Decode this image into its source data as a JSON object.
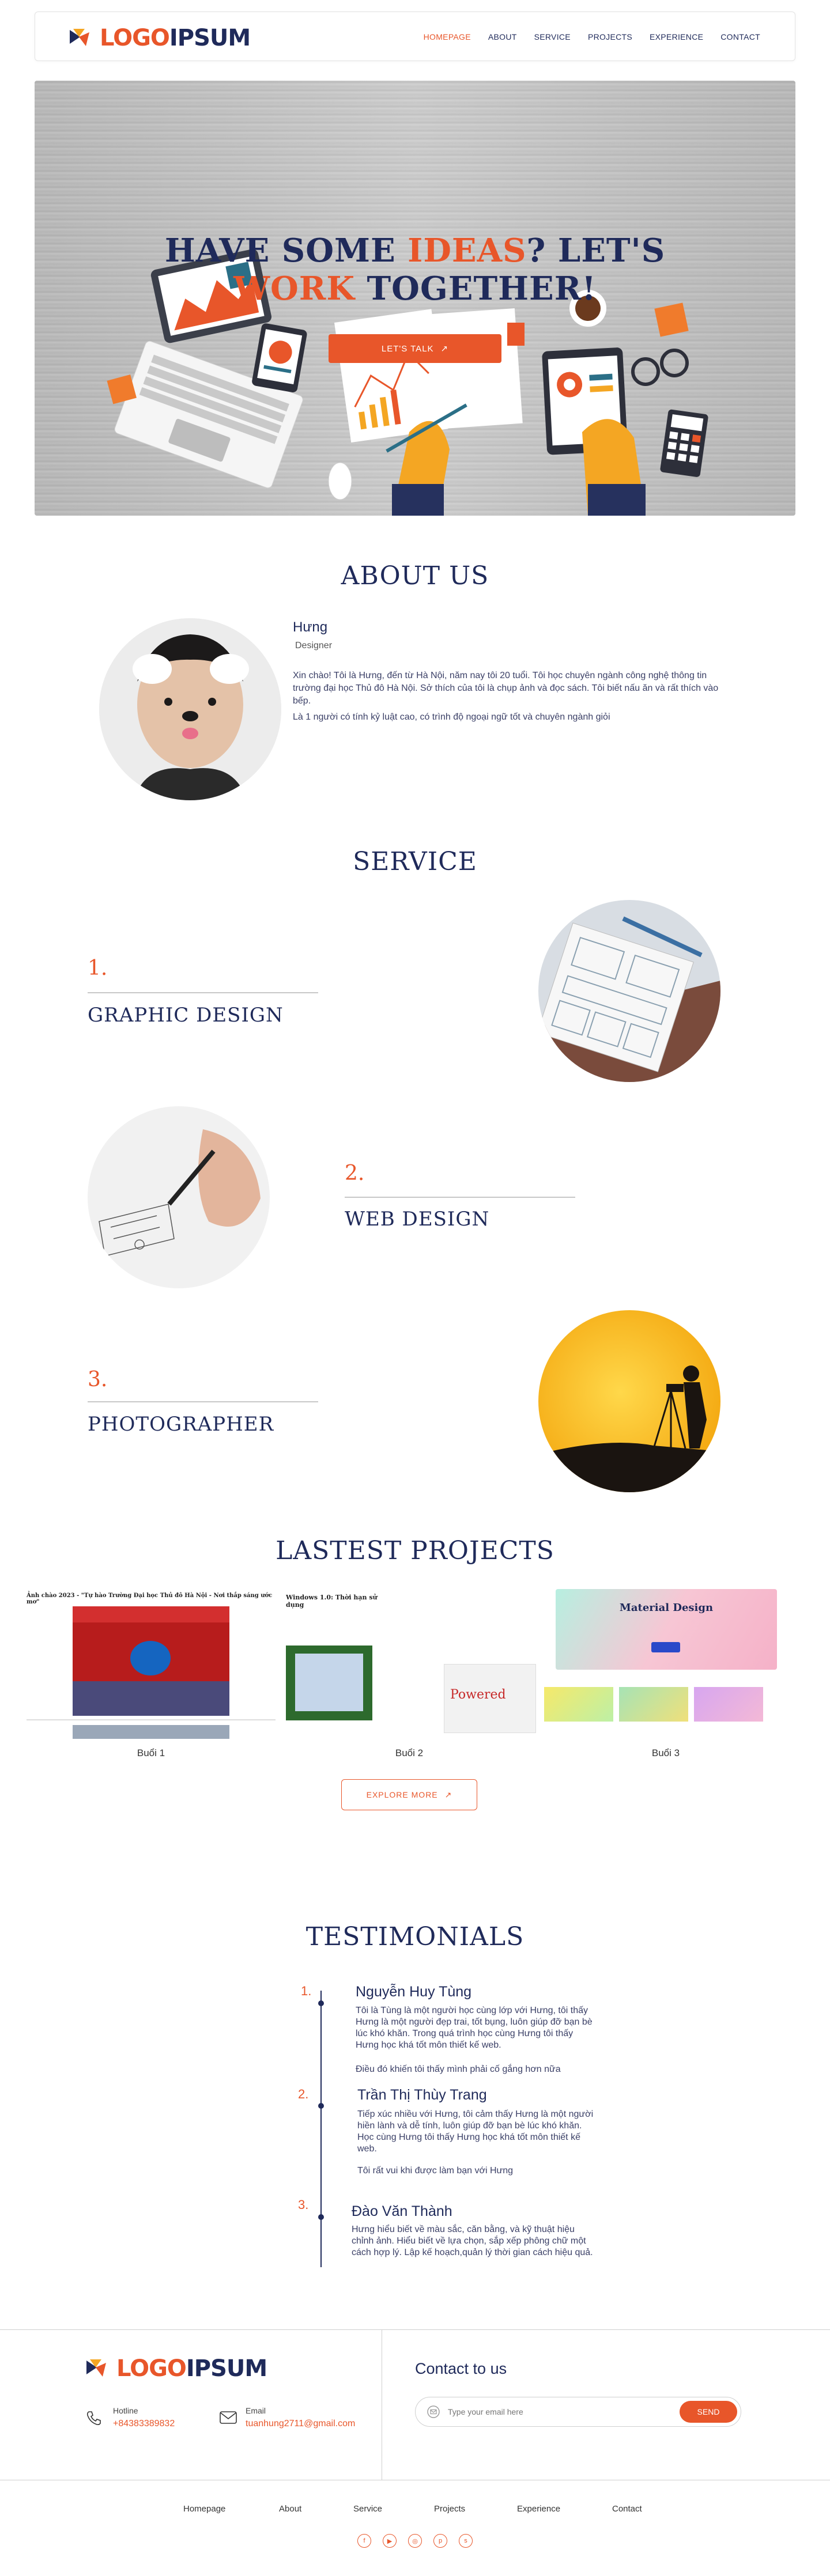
{
  "header": {
    "logo": {
      "part1": "LOGO",
      "part2": "IPSUM"
    },
    "nav": [
      "HOMEPAGE",
      "ABOUT",
      "SERVICE",
      "PROJECTS",
      "EXPERIENCE",
      "CONTACT"
    ],
    "active": "HOMEPAGE"
  },
  "hero": {
    "line1_a": "HAVE SOME ",
    "line1_hl": "IDEAS",
    "line1_b": "? LET'S",
    "line2_hl": "WORK",
    "line2_b": " TOGETHER!",
    "cta": "LET'S TALK"
  },
  "about": {
    "title": "ABOUT US",
    "name": "Hưng",
    "role": "Designer",
    "p1": "Xin chào! Tôi là Hưng, đến từ Hà Nội, năm nay tôi 20 tuổi. Tôi học chuyên ngành công nghệ thông tin trường đại học Thủ đô Hà Nội. Sở thích của tôi là chụp ảnh và đọc sách. Tôi biết nấu ăn và rất thích vào bếp.",
    "p2": "Là 1 người có tính kỷ luật cao, có trình độ ngoại ngữ tốt và chuyên ngành giỏi"
  },
  "service": {
    "title": "SERVICE",
    "items": [
      {
        "num": "1.",
        "name": "GRAPHIC DESIGN"
      },
      {
        "num": "2.",
        "name": "WEB DESIGN"
      },
      {
        "num": "3.",
        "name": "PHOTOGRAPHER"
      }
    ]
  },
  "projects": {
    "title": "LASTEST PROJECTS",
    "items": [
      {
        "label": "Buổi 1",
        "caption": "Ảnh chào 2023 - \"Tự hào Trường Đại học Thủ đô Hà Nội - Nơi thắp sáng ước mơ\""
      },
      {
        "label": "Buổi 2",
        "caption": "Windows 1.0: Thời hạn sử dụng"
      },
      {
        "label": "Buổi 3",
        "caption": "Material Design"
      }
    ],
    "explore": "EXPLORE MORE"
  },
  "testimonials": {
    "title": "TESTIMONIALS",
    "items": [
      {
        "num": "1.",
        "name": "Nguyễn Huy Tùng",
        "text": "Tôi là Tùng là một người học cùng lớp với Hưng, tôi thấy Hưng là một người đẹp trai, tốt bụng, luôn giúp đỡ bạn bè lúc khó khăn. Trong quá trình học cùng Hưng tôi thấy Hưng học khá tốt môn thiết kế web.",
        "extra": "Điều đó khiến tôi thấy mình phải cố gắng hơn nữa"
      },
      {
        "num": "2.",
        "name": "Trần Thị Thùy Trang",
        "text": "Tiếp xúc nhiều với Hưng, tôi cảm thấy Hưng là một người hiền lành và dễ tính, luôn giúp đỡ bạn bè lúc khó khăn. Học cùng Hưng tôi thấy Hưng học khá tốt môn thiết kế web.",
        "extra": "Tôi rất vui khi được làm bạn với Hưng"
      },
      {
        "num": "3.",
        "name": "Đào Văn Thành",
        "text": "Hưng hiểu biết về màu sắc, căn bằng, và kỹ thuật hiệu chỉnh ảnh. Hiểu biết về lựa chọn, sắp xếp phông chữ một cách hợp lý. Lập kế hoạch,quản lý thời gian cách hiệu quả.",
        "extra": ""
      }
    ]
  },
  "footer": {
    "logo": {
      "part1": "LOGO",
      "part2": "IPSUM"
    },
    "hotline_label": "Hotline",
    "hotline": "+84383389832",
    "email_label": "Email",
    "email": "tuanhung2711@gmail.com",
    "contact_title": "Contact to us",
    "email_placeholder": "Type your email here",
    "send": "SEND",
    "nav": [
      "Homepage",
      "About",
      "Service",
      "Projects",
      "Experience",
      "Contact"
    ],
    "socials": [
      "facebook-icon",
      "youtube-icon",
      "instagram-icon",
      "pinterest-icon",
      "skype-icon"
    ]
  },
  "colors": {
    "accent": "#e8562a",
    "navy": "#1f2a5a"
  }
}
